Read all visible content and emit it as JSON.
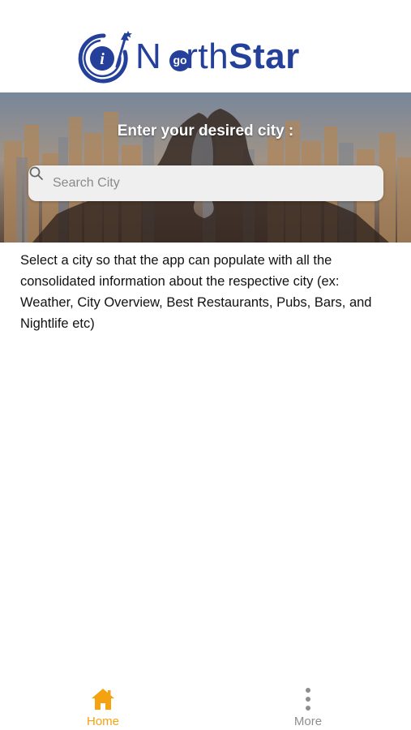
{
  "logo": {
    "text_north": "N",
    "text_go": "go",
    "text_rth": "rth",
    "text_star": "Star",
    "brand_color": "#24409a"
  },
  "hero": {
    "title": "Enter your desired city :",
    "search": {
      "placeholder": "Search City",
      "value": ""
    }
  },
  "description": "Select a city so that the app can populate with all the consolidated information about the respective city (ex: Weather, City Overview, Best Restaurants, Pubs, Bars, and Nightlife etc)",
  "tabbar": {
    "tabs": [
      {
        "label": "Home",
        "icon": "home-icon",
        "active": true,
        "color": "#f5a211"
      },
      {
        "label": "More",
        "icon": "more-vertical-icon",
        "active": false,
        "color": "#8e8e8e"
      }
    ]
  }
}
